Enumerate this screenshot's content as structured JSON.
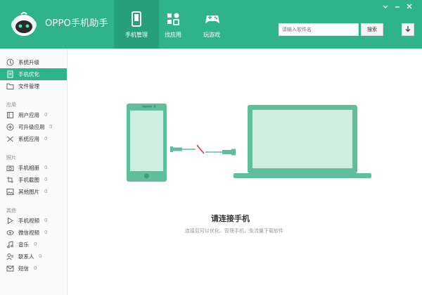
{
  "app": {
    "brand": "OPPO手机助手"
  },
  "nav": {
    "tabs": [
      {
        "label": "手机管理",
        "icon": "phone-icon",
        "active": true
      },
      {
        "label": "找应用",
        "icon": "apps-icon",
        "active": false
      },
      {
        "label": "玩游戏",
        "icon": "gamepad-icon",
        "active": false
      }
    ]
  },
  "search": {
    "placeholder": "请输入软件名",
    "button_label": "搜索"
  },
  "window_controls": [
    "menu",
    "minimize",
    "close"
  ],
  "sidebar": {
    "top_items": [
      {
        "label": "系统升级",
        "icon": "upgrade-icon",
        "active": false
      },
      {
        "label": "手机优化",
        "icon": "optimize-icon",
        "active": true
      },
      {
        "label": "文件管理",
        "icon": "folder-icon",
        "active": false
      }
    ],
    "apps_group": {
      "title": "应用",
      "items": [
        {
          "label": "用户应用",
          "count": "0",
          "icon": "user-apps-icon"
        },
        {
          "label": "可升级应用",
          "count": "0",
          "icon": "upgradable-apps-icon"
        },
        {
          "label": "系统应用",
          "count": "0",
          "icon": "system-apps-icon"
        }
      ]
    },
    "photos_group": {
      "title": "照片",
      "items": [
        {
          "label": "手机相册",
          "count": "0",
          "icon": "camera-icon"
        },
        {
          "label": "手机截图",
          "count": "0",
          "icon": "screenshot-icon"
        },
        {
          "label": "其他图片",
          "count": "0",
          "icon": "image-icon"
        }
      ]
    },
    "other_group": {
      "title": "其他",
      "items": [
        {
          "label": "手机视频",
          "count": "0",
          "icon": "video-icon"
        },
        {
          "label": "微信视频",
          "count": "0",
          "icon": "eye-icon"
        },
        {
          "label": "音乐",
          "count": "0",
          "icon": "music-icon"
        },
        {
          "label": "联系人",
          "count": "0",
          "icon": "contacts-icon"
        },
        {
          "label": "短信",
          "count": "0",
          "icon": "message-icon"
        }
      ]
    }
  },
  "main": {
    "title": "请连接手机",
    "subtitle": "连接后可以优化、管理手机，免流量下载软件"
  },
  "colors": {
    "accent": "#2fb38a",
    "accent_dark": "#26a07b",
    "illustration": "#5fbf9a"
  }
}
